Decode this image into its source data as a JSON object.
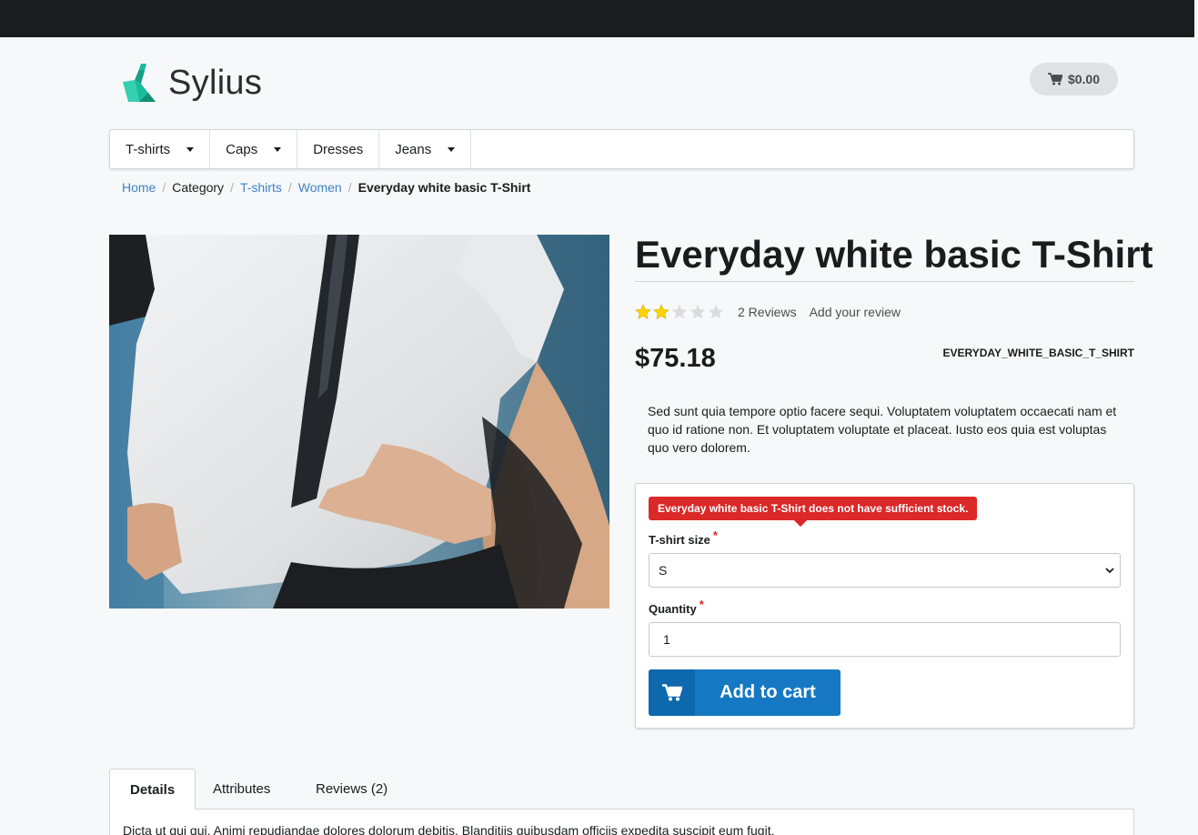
{
  "brand": {
    "name": "Sylius"
  },
  "header": {
    "cart_total": "$0.00"
  },
  "menu": {
    "items": [
      {
        "label": "T-shirts",
        "has_dropdown": true
      },
      {
        "label": "Caps",
        "has_dropdown": true
      },
      {
        "label": "Dresses",
        "has_dropdown": false
      },
      {
        "label": "Jeans",
        "has_dropdown": true
      }
    ]
  },
  "breadcrumb": {
    "home": "Home",
    "category": "Category",
    "tshirts": "T-shirts",
    "women": "Women",
    "current": "Everyday white basic T-Shirt"
  },
  "product": {
    "title": "Everyday white basic T-Shirt",
    "rating": 2,
    "rating_max": 5,
    "reviews_link": "2 Reviews",
    "add_review_link": "Add your review",
    "price": "$75.18",
    "sku": "EVERYDAY_WHITE_BASIC_T_SHIRT",
    "description": "Sed sunt quia tempore optio facere sequi. Voluptatem voluptatem occaecati nam et quo id ratione non. Et voluptatem voluptate et placeat. Iusto eos quia est voluptas quo vero dolorem."
  },
  "cart_form": {
    "error": "Everyday white basic T-Shirt does not have sufficient stock.",
    "size_label": "T-shirt size",
    "size_value": "S",
    "quantity_label": "Quantity",
    "quantity_value": "1",
    "required_mark": "*",
    "add_to_cart": "Add to cart"
  },
  "tabs": {
    "details": "Details",
    "attributes": "Attributes",
    "reviews": "Reviews (2)",
    "details_text": "Dicta ut qui qui. Animi repudiandae dolores dolorum debitis. Blanditiis quibusdam officiis expedita suscipit eum fugit."
  },
  "colors": {
    "brand_green": "#1abb9c",
    "primary_blue": "#1678c2",
    "error_red": "#db2828",
    "link_blue": "#4183c4",
    "star_yellow": "#ffd400"
  },
  "icons": {
    "cart": "shopping-cart-icon",
    "logo": "sylius-swan-logo",
    "dropdown": "caret-down-icon",
    "star": "star-icon"
  }
}
